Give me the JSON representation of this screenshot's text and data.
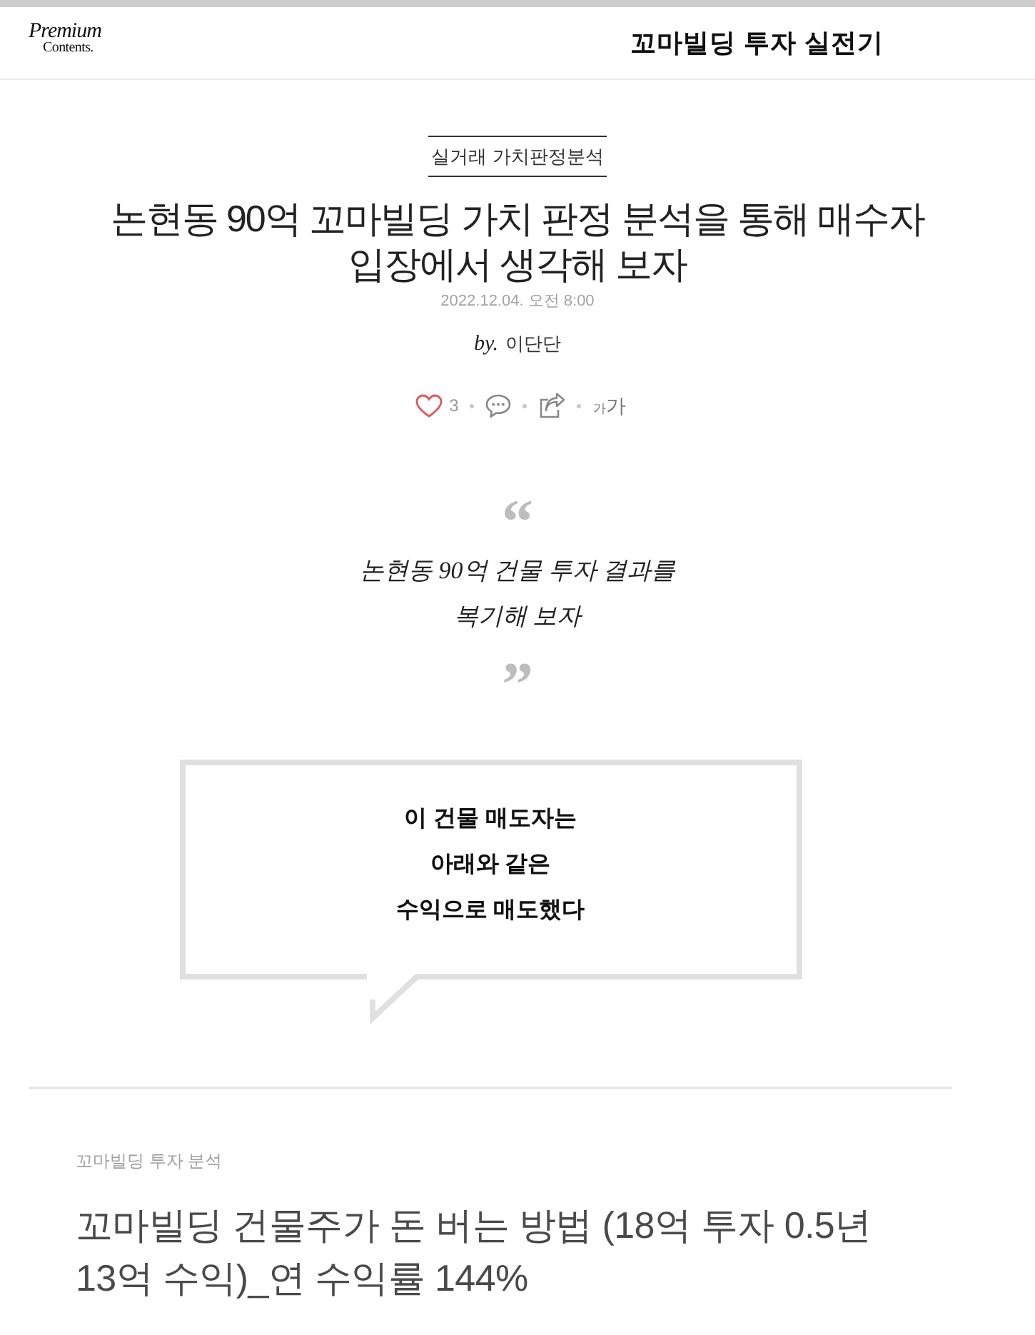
{
  "header": {
    "logo": {
      "line_1": "Premium",
      "line_2": "Contents."
    },
    "title": "꼬마빌딩 투자 실전기"
  },
  "article": {
    "category": "실거래 가치판정분석",
    "title": "논현동 90억 꼬마빌딩 가치 판정 분석을 통해 매수자 입장에서 생각해 보자",
    "date": "2022.12.04. 오전 8:00",
    "byline": {
      "prefix": "by.",
      "author": "이단단"
    },
    "actions": {
      "like_count": "3",
      "font_size": {
        "small": "가",
        "large": "가"
      }
    }
  },
  "quote": {
    "open_mark": "“",
    "lines": [
      "논현동 90억 건물 투자 결과를",
      "복기해 보자"
    ],
    "close_mark": "”"
  },
  "speech_bubble": {
    "lines": [
      "이 건물 매도자는",
      "아래와 같은",
      "수익으로 매도했다"
    ]
  },
  "next_post": {
    "category": "꼬마빌딩 투자 분석",
    "title": "꼬마빌딩 건물주가 돈 버는 방법 (18억 투자 0.5년 13억 수익)_연 수익률 144%"
  }
}
